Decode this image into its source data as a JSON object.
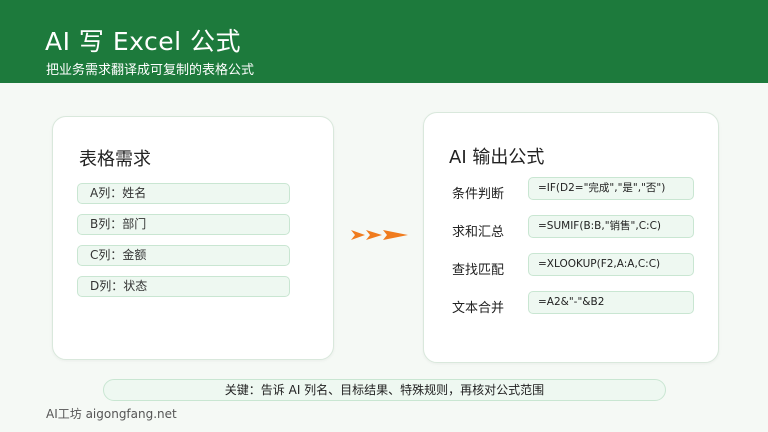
{
  "header": {
    "title": "AI 写 Excel 公式",
    "subtitle": "把业务需求翻译成可复制的表格公式",
    "bg_color": "#1d7a3c"
  },
  "left_card": {
    "title": "表格需求",
    "items": [
      "A列：姓名",
      "B列：部门",
      "C列：金额",
      "D列：状态"
    ]
  },
  "right_card": {
    "title": "AI 输出公式",
    "rows": [
      {
        "label": "条件判断",
        "formula": "=IF(D2=\"完成\",\"是\",\"否\")"
      },
      {
        "label": "求和汇总",
        "formula": "=SUMIF(B:B,\"销售\",C:C)"
      },
      {
        "label": "查找匹配",
        "formula": "=XLOOKUP(F2,A:A,C:C)"
      },
      {
        "label": "文本合并",
        "formula": "=A2&\"-\"&B2"
      }
    ]
  },
  "arrow": {
    "icon": "triple-chevron-arrow-icon",
    "color": "#f07c1e"
  },
  "key_note": "关键：告诉 AI 列名、目标结果、特殊规则，再核对公式范围",
  "footer": "AI工坊 aigongfang.net"
}
